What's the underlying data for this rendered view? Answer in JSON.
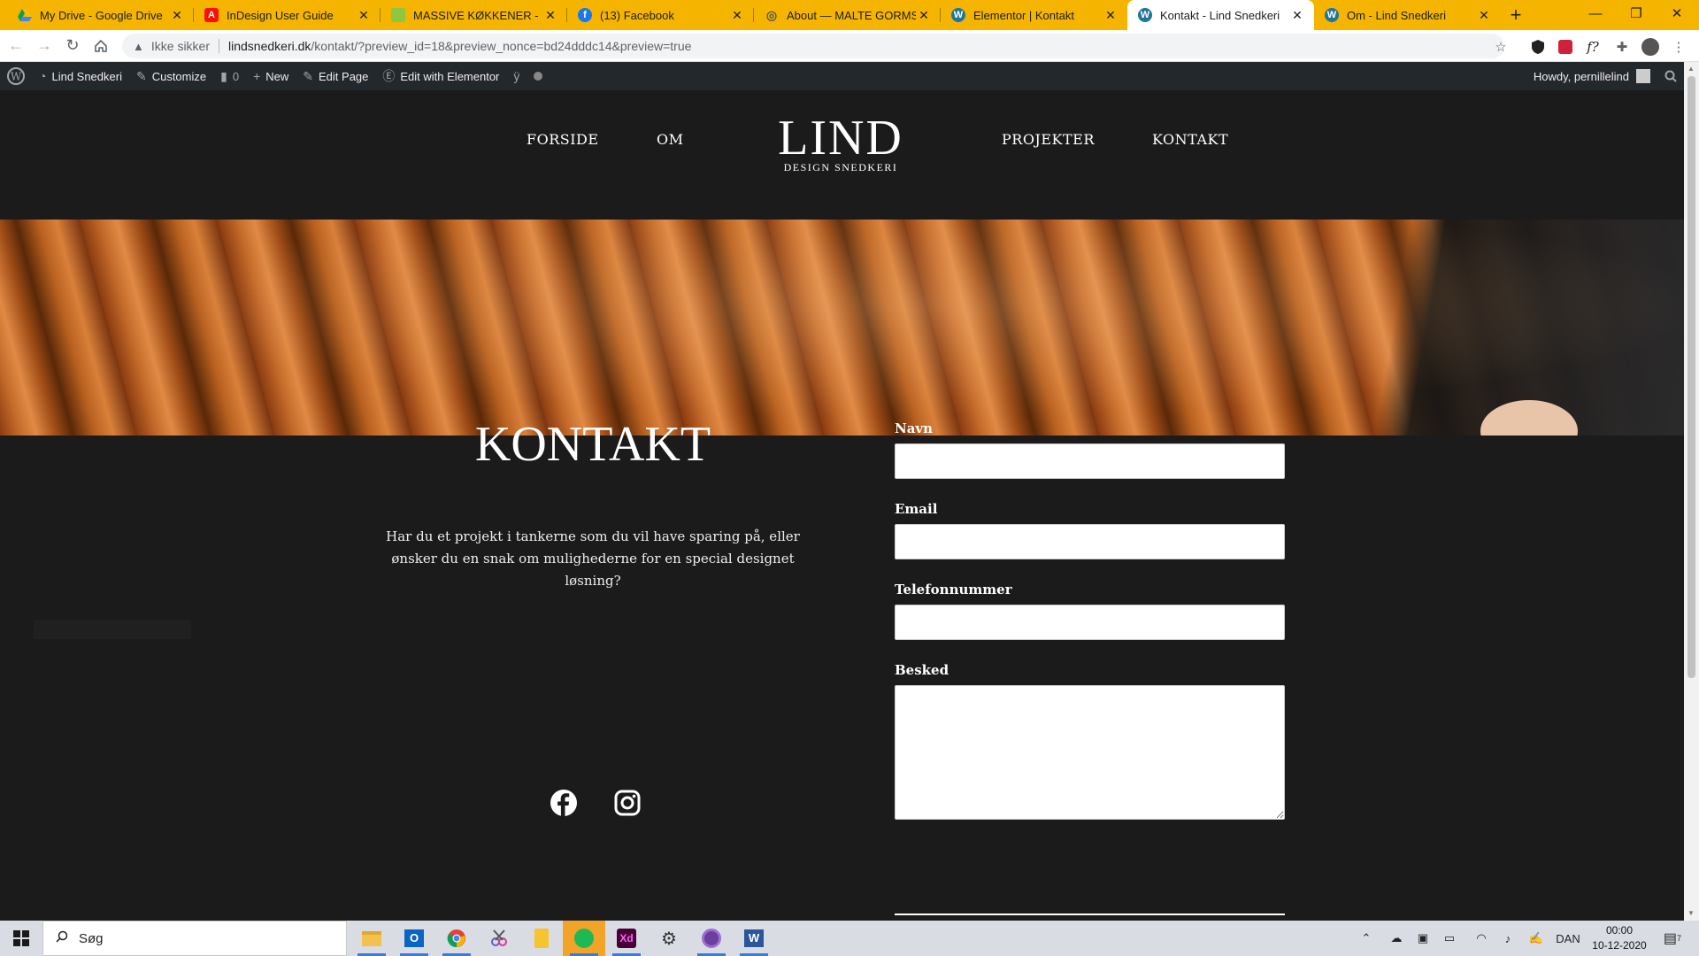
{
  "browser": {
    "tabs": [
      {
        "title": "My Drive - Google Drive",
        "icon": "google-drive-icon",
        "active": false
      },
      {
        "title": "InDesign User Guide",
        "icon": "adobe-icon",
        "active": false
      },
      {
        "title": "MASSIVE KØKKENER - Søg",
        "icon": "green-square-icon",
        "active": false
      },
      {
        "title": "(13) Facebook",
        "icon": "facebook-icon",
        "active": false
      },
      {
        "title": "About — MALTE GORMSEN",
        "icon": "globe-icon",
        "active": false
      },
      {
        "title": "Elementor | Kontakt",
        "icon": "wordpress-icon",
        "active": false
      },
      {
        "title": "Kontakt - Lind Snedkeri",
        "icon": "wordpress-icon",
        "active": true
      },
      {
        "title": "Om - Lind Snedkeri",
        "icon": "wordpress-icon",
        "active": false
      }
    ],
    "new_tab": "+",
    "address": {
      "security_label": "Ikke sikker",
      "host": "lindsnedkeri.dk",
      "path": "/kontakt/?preview_id=18&preview_nonce=bd24dddc14&preview=true"
    }
  },
  "wp_admin_bar": {
    "site_name": "Lind Snedkeri",
    "customize": "Customize",
    "comments_count": "0",
    "new": "New",
    "edit_page": "Edit Page",
    "edit_elementor": "Edit with Elementor",
    "howdy": "Howdy, pernillelind"
  },
  "site": {
    "nav": {
      "items": [
        "FORSIDE",
        "OM",
        "PROJEKTER",
        "KONTAKT"
      ],
      "logo_main": "LIND",
      "logo_sub": "DESIGN SNEDKERI"
    },
    "contact": {
      "title": "KONTAKT",
      "intro": "Har du et projekt i tankerne som du vil have sparing på, eller ønsker du en snak om mulighederne for en special designet løsning?"
    },
    "form": {
      "name_label": "Navn",
      "email_label": "Email",
      "phone_label": "Telefonnummer",
      "message_label": "Besked"
    },
    "social": [
      "facebook-icon",
      "instagram-icon"
    ]
  },
  "taskbar": {
    "search_placeholder": "Søg",
    "language": "DAN",
    "time": "00:00",
    "date": "10-12-2020",
    "notification_count": "7"
  }
}
